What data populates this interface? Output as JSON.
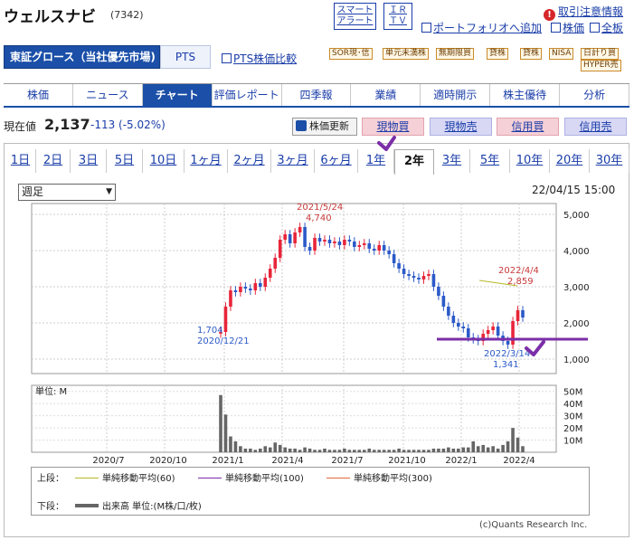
{
  "header": {
    "title": "ウェルスナビ",
    "code": "(7342)",
    "smart_alert": "スマート\nアラート",
    "irtv": "ＩＲ\nＴＶ",
    "portfolio_add": "ポートフォリオへ追加",
    "warning": "取引注意情報",
    "stock_price_link": "株価",
    "full_view_link": "全板"
  },
  "market": {
    "name": "東証グロース（当社優先市場)",
    "pts": "PTS",
    "pts_compare": "PTS株価比較"
  },
  "tags": [
    "SOR現･信",
    "単元未満株",
    "無期限買",
    "貸株",
    "貸株",
    "NISA",
    "日計り買",
    "HYPER売"
  ],
  "nav": {
    "tabs": [
      "株価",
      "ニュース",
      "チャート",
      "評価レポート",
      "四季報",
      "業績",
      "適時開示",
      "株主優待",
      "分析"
    ],
    "active": 2
  },
  "quote": {
    "label": "現在値",
    "price": "2,137",
    "change": "-113 (-5.02%)",
    "update_button": "株価更新",
    "buy_spot": "現物買",
    "sell_spot": "現物売",
    "buy_margin": "信用買",
    "sell_margin": "信用売"
  },
  "periods": {
    "tabs": [
      "1日",
      "2日",
      "3日",
      "5日",
      "10日",
      "1ヶ月",
      "2ヶ月",
      "3ヶ月",
      "6ヶ月",
      "1年",
      "2年",
      "3年",
      "5年",
      "10年",
      "20年",
      "30年"
    ],
    "active": 10
  },
  "range_select": "週足",
  "timestamp": "22/04/15 15:00",
  "chart_data": {
    "type": "candlestick",
    "y_ticks": [
      "5,000",
      "4,000",
      "3,000",
      "2,000",
      "1,000"
    ],
    "ylim": [
      1000,
      5000
    ],
    "x_ticks": [
      "2020/7",
      "2020/10",
      "2021/1",
      "2021/4",
      "2021/7",
      "2021/10",
      "2022/1",
      "2022/4"
    ],
    "annotations": [
      {
        "date": "2021/5/24",
        "value": "4,740",
        "color": "#c83b3b"
      },
      {
        "date": "2022/4/4",
        "value": "2,859",
        "color": "#c83b3b"
      },
      {
        "date": "2020/12/21",
        "value": "1,704",
        "color": "#2b5ac8"
      },
      {
        "date": "2022/3/14",
        "value": "1,341",
        "color": "#2b5ac8"
      }
    ],
    "colors": {
      "up": "#e8253a",
      "down": "#2b5ac8",
      "volume": "#666666"
    },
    "weekly_close": [
      1750,
      2450,
      2900,
      2850,
      3000,
      2950,
      2900,
      3100,
      3000,
      3250,
      3500,
      3800,
      4300,
      4450,
      4200,
      4500,
      4650,
      4100,
      4000,
      4350,
      4250,
      4300,
      4200,
      4250,
      4150,
      4300,
      4250,
      4100,
      4150,
      4200,
      4050,
      4000,
      4150,
      4000,
      3900,
      3650,
      3500,
      3350,
      3300,
      3250,
      3200,
      3300,
      3350,
      3000,
      2750,
      2450,
      2200,
      2000,
      1900,
      1850,
      1600,
      1550,
      1500,
      1700,
      1800,
      1900,
      1650,
      1500,
      1400,
      2050,
      2350,
      2150
    ],
    "volume_label": "単位: M",
    "volume_ticks": [
      "50M",
      "40M",
      "30M",
      "20M",
      "10M"
    ],
    "volume_ylim": [
      0,
      50
    ],
    "weekly_volume": [
      47,
      31,
      13,
      9,
      5,
      3,
      3,
      2,
      3,
      5,
      4,
      8,
      6,
      4,
      3,
      3,
      2,
      4,
      3,
      2,
      2,
      3,
      2,
      2,
      2,
      3,
      2,
      2,
      2,
      2,
      3,
      2,
      2,
      2,
      2,
      2,
      3,
      2,
      2,
      2,
      2,
      2,
      2,
      3,
      3,
      3,
      4,
      3,
      3,
      4,
      4,
      9,
      5,
      6,
      4,
      5,
      3,
      6,
      9,
      20,
      12,
      5
    ]
  },
  "legend": {
    "upper_label": "上段：",
    "ma60": "単純移動平均(60)",
    "ma100": "単純移動平均(100)",
    "ma300": "単純移動平均(300)",
    "lower_label": "下段：",
    "volume": "出来高 単位:(M株/口/枚)",
    "colors": {
      "ma60": "#b5b827",
      "ma100": "#7b2ea8",
      "ma300": "#e06a3a",
      "volume": "#666666"
    }
  },
  "copyright": "(c)Quants Research Inc."
}
